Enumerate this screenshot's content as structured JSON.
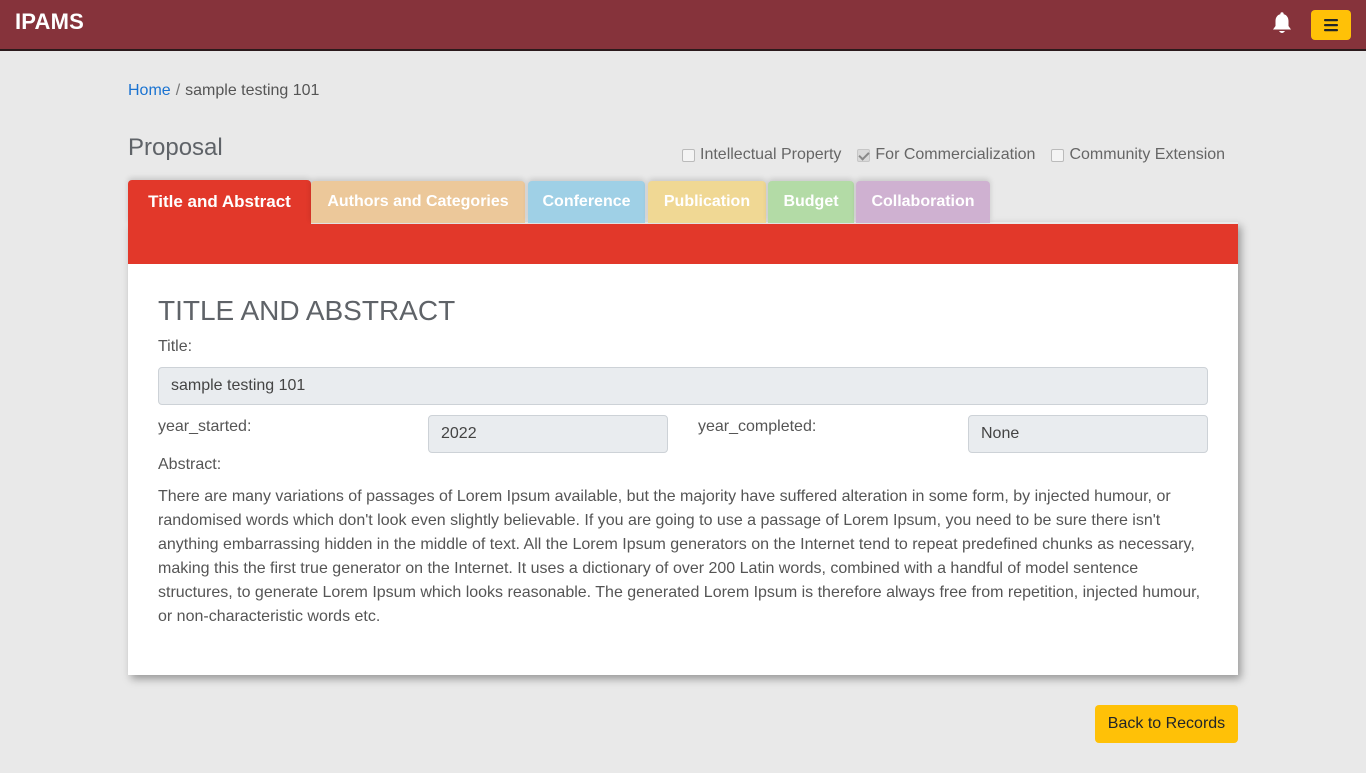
{
  "app": {
    "brand": "IPAMS"
  },
  "navbar": {
    "bell_icon": "bell-icon",
    "menu_icon": "hamburger-menu-icon",
    "background": "#86333b",
    "menu_button_color": "#ffc107"
  },
  "breadcrumb": {
    "home": "Home",
    "separator": "/",
    "current": "sample testing 101"
  },
  "proposal": {
    "heading": "Proposal",
    "checks": [
      {
        "label": "Intellectual Property",
        "checked": false
      },
      {
        "label": "For Commercialization",
        "checked": true
      },
      {
        "label": "Community Extension",
        "checked": false
      }
    ]
  },
  "tabs": [
    {
      "label": "Title and Abstract",
      "color": "#e2382a",
      "active": true
    },
    {
      "label": "Authors and Categories",
      "color": "#ecc89a",
      "active": false
    },
    {
      "label": "Conference",
      "color": "#9fd0e6",
      "active": false
    },
    {
      "label": "Publication",
      "color": "#f0d894",
      "active": false
    },
    {
      "label": "Budget",
      "color": "#b3dba6",
      "active": false
    },
    {
      "label": "Collaboration",
      "color": "#cfb1d1",
      "active": false
    }
  ],
  "section": {
    "title": "TITLE AND ABSTRACT",
    "title_label": "Title:",
    "title_value": "sample testing 101",
    "year_started_label": "year_started:",
    "year_started_value": "2022",
    "year_completed_label": "year_completed:",
    "year_completed_value": "None",
    "abstract_label": "Abstract:",
    "abstract_text": "There are many variations of passages of Lorem Ipsum available, but the majority have suffered alteration in some form, by injected humour, or randomised words which don't look even slightly believable. If you are going to use a passage of Lorem Ipsum, you need to be sure there isn't anything embarrassing hidden in the middle of text. All the Lorem Ipsum generators on the Internet tend to repeat predefined chunks as necessary, making this the first true generator on the Internet. It uses a dictionary of over 200 Latin words, combined with a handful of model sentence structures, to generate Lorem Ipsum which looks reasonable. The generated Lorem Ipsum is therefore always free from repetition, injected humour, or non-characteristic words etc."
  },
  "footer": {
    "back_button": "Back to Records",
    "back_button_color": "#ffc107"
  }
}
